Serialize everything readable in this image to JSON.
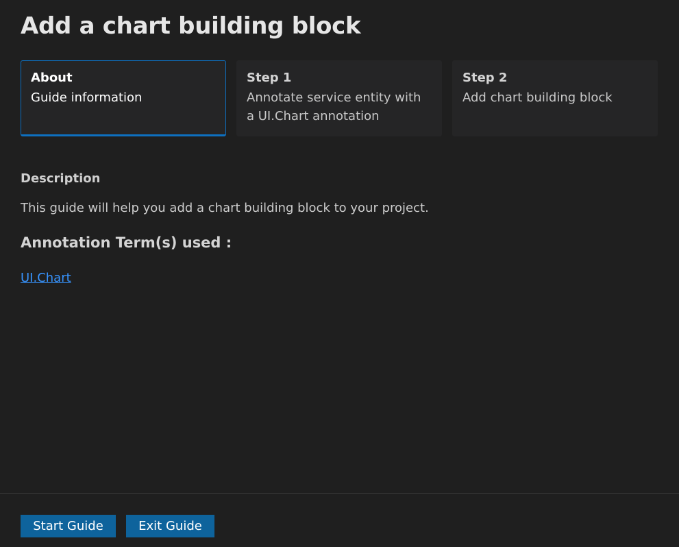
{
  "title": "Add a chart building block",
  "steps": [
    {
      "title": "About",
      "description": "Guide information",
      "active": true
    },
    {
      "title": "Step 1",
      "description": "Annotate service entity with a UI.Chart annotation",
      "active": false
    },
    {
      "title": "Step 2",
      "description": "Add chart building block",
      "active": false
    }
  ],
  "description": {
    "label": "Description",
    "text": "This guide will help you add a chart building block to your project."
  },
  "annotation_terms": {
    "heading": "Annotation Term(s) used :",
    "links": [
      "UI.Chart"
    ]
  },
  "footer": {
    "start_label": "Start Guide",
    "exit_label": "Exit Guide"
  },
  "colors": {
    "background": "#1f1f1f",
    "card": "#252526",
    "accent": "#0e70c0",
    "button": "#0e639c",
    "link": "#3794ff"
  }
}
